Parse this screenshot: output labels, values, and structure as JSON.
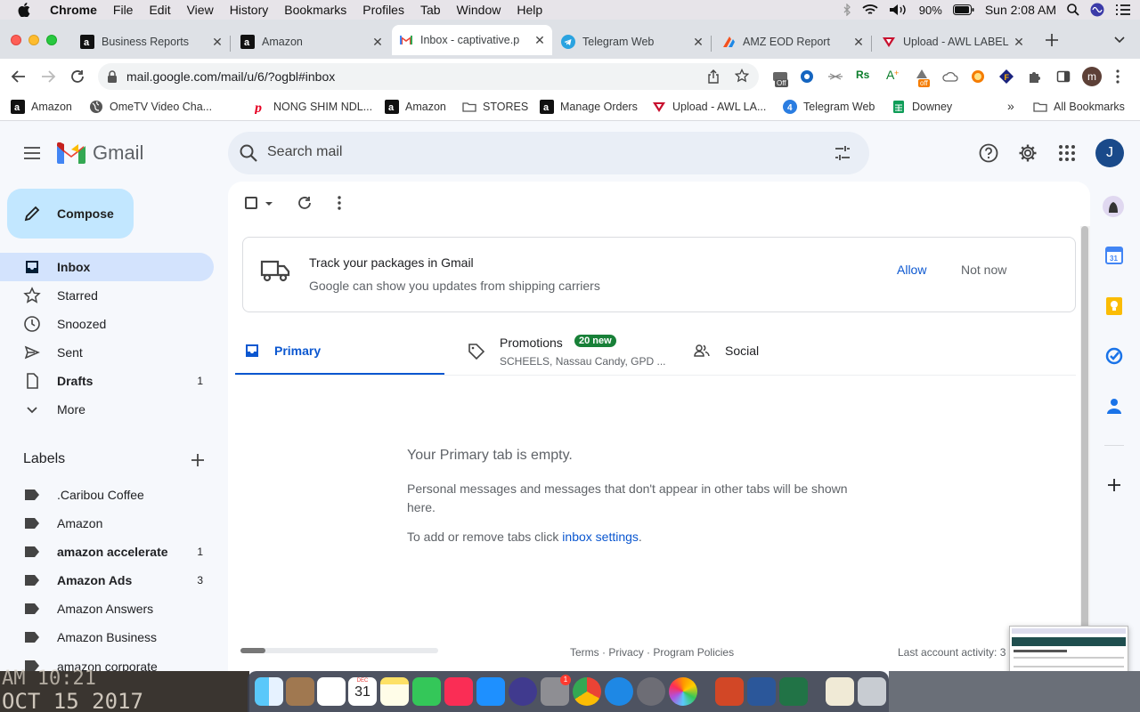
{
  "menubar": {
    "app": "Chrome",
    "menus": [
      "File",
      "Edit",
      "View",
      "History",
      "Bookmarks",
      "Profiles",
      "Tab",
      "Window",
      "Help"
    ],
    "battery": "90%",
    "clock": "Sun 2:08 AM"
  },
  "tabs": [
    {
      "title": "Business Reports"
    },
    {
      "title": "Amazon"
    },
    {
      "title": "Inbox - captivative.p"
    },
    {
      "title": "Telegram Web"
    },
    {
      "title": "AMZ EOD Report"
    },
    {
      "title": "Upload - AWL LABEL"
    }
  ],
  "omnibox": {
    "url": "mail.google.com/mail/u/6/?ogbl#inbox"
  },
  "extensions": {
    "badge_off_1": "Off",
    "badge_off_2": "off",
    "profile_letter": "m"
  },
  "bookmarks": [
    {
      "label": "Amazon"
    },
    {
      "label": "OmeTV Video Cha..."
    },
    {
      "label": "NONG SHIM NDL..."
    },
    {
      "label": "Amazon"
    },
    {
      "label": "STORES"
    },
    {
      "label": "Manage Orders"
    },
    {
      "label": "Upload - AWL LA..."
    },
    {
      "label": "Telegram Web"
    },
    {
      "label": "Downey"
    }
  ],
  "bookmarks_more": "»",
  "all_bookmarks": "All Bookmarks",
  "gmail": {
    "logo_text": "Gmail",
    "search_placeholder": "Search mail",
    "avatar_letter": "J",
    "compose": "Compose",
    "nav": [
      {
        "label": "Inbox",
        "count": ""
      },
      {
        "label": "Starred",
        "count": ""
      },
      {
        "label": "Snoozed",
        "count": ""
      },
      {
        "label": "Sent",
        "count": ""
      },
      {
        "label": "Drafts",
        "count": "1"
      },
      {
        "label": "More",
        "count": ""
      }
    ],
    "labels_heading": "Labels",
    "labels": [
      {
        "label": ".Caribou Coffee",
        "count": ""
      },
      {
        "label": "Amazon",
        "count": ""
      },
      {
        "label": "amazon accelerate",
        "count": "1"
      },
      {
        "label": "Amazon Ads",
        "count": "3"
      },
      {
        "label": "Amazon Answers",
        "count": ""
      },
      {
        "label": "Amazon Business",
        "count": ""
      },
      {
        "label": "amazon corporate",
        "count": ""
      }
    ],
    "banner": {
      "title": "Track your packages in Gmail",
      "subtitle": "Google can show you updates from shipping carriers",
      "allow": "Allow",
      "not_now": "Not now"
    },
    "inbox_tabs": {
      "primary": "Primary",
      "promotions": "Promotions",
      "promotions_badge": "20 new",
      "promotions_senders": "SCHEELS, Nassau Candy, GPD ...",
      "social": "Social"
    },
    "empty": {
      "title": "Your Primary tab is empty.",
      "body": "Personal messages and messages that don't appear in other tabs will be shown here.",
      "settings_prefix": "To add or remove tabs click ",
      "settings_link": "inbox settings",
      "settings_suffix": "."
    },
    "footer": {
      "terms": "Terms",
      "privacy": "Privacy",
      "policies": "Program Policies",
      "sep": "·",
      "last_activity": "Last account activity: 3"
    }
  },
  "desktop": {
    "clock_line1": "AM 10:21",
    "clock_line2": "OCT 15 2017"
  },
  "dock": {
    "calendar_day": "31",
    "calendar_month": "DEC",
    "badge": "1"
  }
}
